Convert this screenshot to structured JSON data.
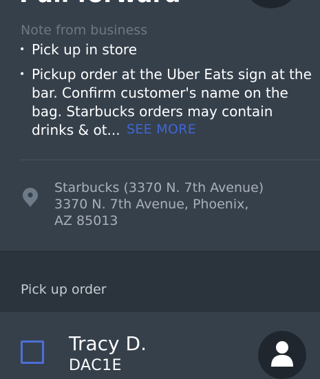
{
  "header": {
    "title": "Pull forward"
  },
  "note": {
    "label": "Note from business",
    "bullets": [
      "Pick up in store",
      "Pickup order at the Uber Eats sign at the bar. Confirm customer's name on the bag. Starbucks orders may contain drinks & ot..."
    ],
    "bullet_glyph": "•",
    "see_more": "SEE MORE"
  },
  "location": {
    "icon": "location-pin-icon",
    "line1": "Starbucks (3370 N. 7th Avenue)",
    "line2": "3370 N. 7th Avenue, Phoenix,",
    "line3": "AZ 85013"
  },
  "section": {
    "label": "Pick up order"
  },
  "order": {
    "customer_name": "Tracy D.",
    "code": "DAC1E",
    "checked": false
  },
  "colors": {
    "background": "#36404b",
    "band": "#2b333c",
    "accent": "#3f66d6",
    "muted_text": "#a9b1ba"
  }
}
